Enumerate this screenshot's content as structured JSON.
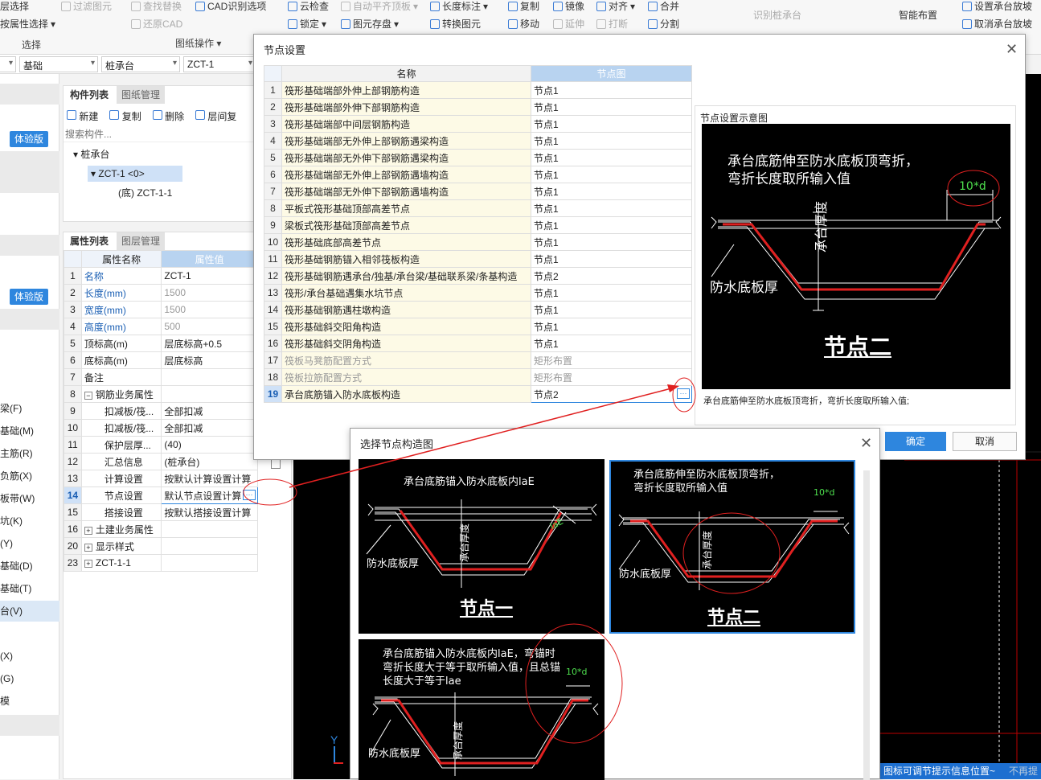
{
  "ribbon": {
    "items": [
      {
        "label": "层选择",
        "dim": false
      },
      {
        "label": "过滤图元",
        "dim": true
      },
      {
        "label": "查找替换",
        "dim": true
      },
      {
        "label": "CAD识别选项",
        "dim": false
      },
      {
        "label": "云检查",
        "dim": false
      },
      {
        "label": "自动平齐顶板",
        "dim": true
      },
      {
        "label": "长度标注",
        "dim": false
      },
      {
        "label": "复制",
        "dim": false
      },
      {
        "label": "镜像",
        "dim": false
      },
      {
        "label": "对齐",
        "dim": false
      },
      {
        "label": "合并",
        "dim": false
      },
      {
        "label": "设置承台放坡",
        "dim": false
      },
      {
        "label": "按属性选择",
        "dim": false
      },
      {
        "label": "还原CAD",
        "dim": true
      },
      {
        "label": "锁定",
        "dim": false
      },
      {
        "label": "图元存盘",
        "dim": false
      },
      {
        "label": "转换图元",
        "dim": false
      },
      {
        "label": "移动",
        "dim": false
      },
      {
        "label": "延伸",
        "dim": true
      },
      {
        "label": "打断",
        "dim": true
      },
      {
        "label": "分割",
        "dim": false
      },
      {
        "label": "取消承台放坡",
        "dim": false
      }
    ],
    "groups": {
      "select": "选择",
      "drawing_ops": "图纸操作"
    },
    "recognize": "识别桩承台",
    "smart_layout": "智能布置"
  },
  "selectors": [
    "基础",
    "桩承台",
    "ZCT-1"
  ],
  "left_nav": {
    "trial_label": "体验版",
    "items": [
      "梁(F)",
      "基础(M)",
      "主筋(R)",
      "负筋(X)",
      "板带(W)",
      "坑(K)",
      "(Y)",
      "基础(D)",
      "基础(T)",
      "台(V)",
      "(X)",
      "(G)",
      "模"
    ]
  },
  "component_panel": {
    "tabs": [
      "构件列表",
      "图纸管理"
    ],
    "toolbar": [
      "新建",
      "复制",
      "删除",
      "层间复"
    ],
    "search_placeholder": "搜索构件...",
    "tree": {
      "root": "桩承台",
      "child": "ZCT-1 <0>",
      "leaf": "(底) ZCT-1-1"
    }
  },
  "props_panel": {
    "tabs": [
      "属性列表",
      "图层管理"
    ],
    "headers": [
      "属性名称",
      "属性值"
    ],
    "rows": [
      {
        "num": "1",
        "name": "名称",
        "value": "ZCT-1",
        "blue": true
      },
      {
        "num": "2",
        "name": "长度(mm)",
        "value": "1500",
        "blue": true,
        "gray": true
      },
      {
        "num": "3",
        "name": "宽度(mm)",
        "value": "1500",
        "blue": true,
        "gray": true
      },
      {
        "num": "4",
        "name": "高度(mm)",
        "value": "500",
        "blue": true,
        "gray": true
      },
      {
        "num": "5",
        "name": "顶标高(m)",
        "value": "层底标高+0.5"
      },
      {
        "num": "6",
        "name": "底标高(m)",
        "value": "层底标高"
      },
      {
        "num": "7",
        "name": "备注",
        "value": ""
      },
      {
        "num": "8",
        "name": "钢筋业务属性",
        "value": "",
        "group": true
      },
      {
        "num": "9",
        "name": "扣减板/筏...",
        "value": "全部扣减",
        "indent": true
      },
      {
        "num": "10",
        "name": "扣减板/筏...",
        "value": "全部扣减",
        "indent": true
      },
      {
        "num": "11",
        "name": "保护层厚...",
        "value": "(40)",
        "indent": true
      },
      {
        "num": "12",
        "name": "汇总信息",
        "value": "(桩承台)",
        "indent": true
      },
      {
        "num": "13",
        "name": "计算设置",
        "value": "按默认计算设置计算",
        "indent": true
      },
      {
        "num": "14",
        "name": "节点设置",
        "value": "默认节点设置计算",
        "indent": true,
        "active": true
      },
      {
        "num": "15",
        "name": "搭接设置",
        "value": "按默认搭接设置计算",
        "indent": true
      },
      {
        "num": "16",
        "name": "土建业务属性",
        "value": "",
        "group": true
      },
      {
        "num": "20",
        "name": "显示样式",
        "value": "",
        "group": true
      },
      {
        "num": "23",
        "name": "ZCT-1-1",
        "value": "",
        "group": true
      }
    ]
  },
  "node_dialog": {
    "title": "节点设置",
    "col_name": "名称",
    "col_graph": "节点图",
    "rows": [
      {
        "num": "1",
        "name": "筏形基础端部外伸上部钢筋构造",
        "value": "节点1"
      },
      {
        "num": "2",
        "name": "筏形基础端部外伸下部钢筋构造",
        "value": "节点1"
      },
      {
        "num": "3",
        "name": "筏形基础端部中间层钢筋构造",
        "value": "节点1"
      },
      {
        "num": "4",
        "name": "筏形基础端部无外伸上部钢筋遇梁构造",
        "value": "节点1"
      },
      {
        "num": "5",
        "name": "筏形基础端部无外伸下部钢筋遇梁构造",
        "value": "节点1"
      },
      {
        "num": "6",
        "name": "筏形基础端部无外伸上部钢筋遇墙构造",
        "value": "节点1"
      },
      {
        "num": "7",
        "name": "筏形基础端部无外伸下部钢筋遇墙构造",
        "value": "节点1"
      },
      {
        "num": "8",
        "name": "平板式筏形基础顶部高差节点",
        "value": "节点1"
      },
      {
        "num": "9",
        "name": "梁板式筏形基础顶部高差节点",
        "value": "节点1"
      },
      {
        "num": "10",
        "name": "筏形基础底部高差节点",
        "value": "节点1"
      },
      {
        "num": "11",
        "name": "筏形基础钢筋锚入相邻筏板构造",
        "value": "节点1"
      },
      {
        "num": "12",
        "name": "筏形基础钢筋遇承台/独基/承台梁/基础联系梁/条基构造",
        "value": "节点2"
      },
      {
        "num": "13",
        "name": "筏形/承台基础遇集水坑节点",
        "value": "节点1"
      },
      {
        "num": "14",
        "name": "筏形基础钢筋遇柱墩构造",
        "value": "节点1"
      },
      {
        "num": "15",
        "name": "筏形基础斜交阳角构造",
        "value": "节点1"
      },
      {
        "num": "16",
        "name": "筏形基础斜交阴角构造",
        "value": "节点1"
      },
      {
        "num": "17",
        "name": "筏板马凳筋配置方式",
        "value": "矩形布置",
        "dim": true
      },
      {
        "num": "18",
        "name": "筏板拉筋配置方式",
        "value": "矩形布置",
        "dim": true
      },
      {
        "num": "19",
        "name": "承台底筋锚入防水底板构造",
        "value": "节点2",
        "selected": true
      }
    ],
    "preview_title": "节点设置示意图",
    "preview_text": "承台底筋伸至防水底板顶弯折，\n弯折长度取所输入值",
    "preview_dim": "10*d",
    "preview_depth": "承台厚度",
    "preview_waterproof": "防水底板厚",
    "preview_node": "节点二",
    "preview_caption": "承台底筋伸至防水底板顶弯折，弯折长度取所输入值;",
    "ok": "确定",
    "cancel": "取消"
  },
  "select_dialog": {
    "title": "选择节点构造图",
    "options": [
      {
        "text": "承台底筋锚入防水底板内laE",
        "node": "节点一",
        "dim": "laE",
        "depth": "承台厚度",
        "waterproof": "防水底板厚"
      },
      {
        "text": "承台底筋伸至防水底板顶弯折，\n弯折长度取所输入值",
        "node": "节点二",
        "dim": "10*d",
        "depth": "承台厚度",
        "waterproof": "防水底板厚"
      },
      {
        "text": "承台底筋锚入防水底板内laE，弯锚时\n弯折长度大于等于取所输入值，且总锚\n长度大于等于lae",
        "node": "",
        "dim": "10*d",
        "depth": "承台厚度",
        "waterproof": "防水底板厚"
      }
    ]
  },
  "status_text": "图标可调节提示信息位置~",
  "status_right": "不再提",
  "axis_y": "Y",
  "colors": {
    "accent": "#2e86de",
    "red": "#e02020",
    "cad_bg": "#000000"
  }
}
